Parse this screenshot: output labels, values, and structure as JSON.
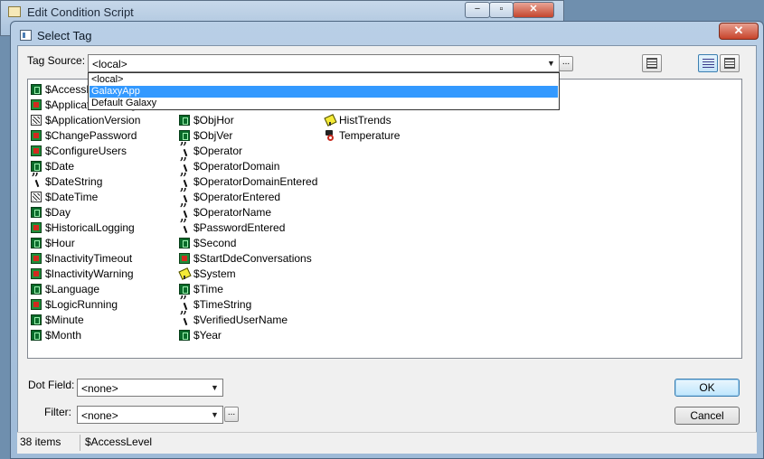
{
  "parent_window": {
    "title": "Edit Condition Script",
    "minimize": "−",
    "maximize": "▫",
    "close": "✕"
  },
  "dialog": {
    "title": "Select Tag",
    "close": "✕"
  },
  "tag_source": {
    "label": "Tag Source:",
    "value": "<local>",
    "arrow": "▼",
    "browse": "...",
    "options": [
      "<local>",
      "GalaxyApp",
      "Default Galaxy"
    ],
    "selected_option": "GalaxyApp"
  },
  "tag_columns": [
    [
      {
        "name": "$AccessLevel",
        "icon": "numeric-tag-icon"
      },
      {
        "name": "$ApplicationChanged",
        "icon": "discrete-tag-icon"
      },
      {
        "name": "$ApplicationVersion",
        "icon": "version-tag-icon"
      },
      {
        "name": "$ChangePassword",
        "icon": "discrete-tag-icon"
      },
      {
        "name": "$ConfigureUsers",
        "icon": "discrete-tag-icon"
      },
      {
        "name": "$Date",
        "icon": "numeric-tag-icon"
      },
      {
        "name": "$DateString",
        "icon": "message-tag-icon"
      },
      {
        "name": "$DateTime",
        "icon": "version-tag-icon"
      },
      {
        "name": "$Day",
        "icon": "numeric-tag-icon"
      },
      {
        "name": "$HistoricalLogging",
        "icon": "discrete-tag-icon"
      },
      {
        "name": "$Hour",
        "icon": "numeric-tag-icon"
      },
      {
        "name": "$InactivityTimeout",
        "icon": "discrete-tag-icon"
      },
      {
        "name": "$InactivityWarning",
        "icon": "discrete-tag-icon"
      },
      {
        "name": "$Language",
        "icon": "numeric-tag-icon"
      },
      {
        "name": "$LogicRunning",
        "icon": "discrete-tag-icon"
      },
      {
        "name": "$Minute",
        "icon": "numeric-tag-icon"
      },
      {
        "name": "$Month",
        "icon": "numeric-tag-icon"
      }
    ],
    [
      {
        "name": "$ObjHor",
        "icon": "numeric-tag-icon"
      },
      {
        "name": "$ObjVer",
        "icon": "numeric-tag-icon"
      },
      {
        "name": "$Operator",
        "icon": "message-tag-icon"
      },
      {
        "name": "$OperatorDomain",
        "icon": "message-tag-icon"
      },
      {
        "name": "$OperatorDomainEntered",
        "icon": "message-tag-icon"
      },
      {
        "name": "$OperatorEntered",
        "icon": "message-tag-icon"
      },
      {
        "name": "$OperatorName",
        "icon": "message-tag-icon"
      },
      {
        "name": "$PasswordEntered",
        "icon": "message-tag-icon"
      },
      {
        "name": "$Second",
        "icon": "numeric-tag-icon"
      },
      {
        "name": "$StartDdeConversations",
        "icon": "discrete-tag-icon"
      },
      {
        "name": "$System",
        "icon": "system-tag-icon"
      },
      {
        "name": "$Time",
        "icon": "numeric-tag-icon"
      },
      {
        "name": "$TimeString",
        "icon": "message-tag-icon"
      },
      {
        "name": "$VerifiedUserName",
        "icon": "message-tag-icon"
      },
      {
        "name": "$Year",
        "icon": "numeric-tag-icon"
      }
    ],
    [
      {
        "name": "HistTrends",
        "icon": "system-tag-icon"
      },
      {
        "name": "Temperature",
        "icon": "temperature-tag-icon"
      }
    ]
  ],
  "dot_field": {
    "label": "Dot Field:",
    "value": "<none>",
    "arrow": "▼"
  },
  "filter": {
    "label": "Filter:",
    "value": "<none>",
    "arrow": "▼",
    "browse": "..."
  },
  "buttons": {
    "ok": "OK",
    "cancel": "Cancel"
  },
  "status": {
    "count": "38 items",
    "selected": "$AccessLevel"
  }
}
